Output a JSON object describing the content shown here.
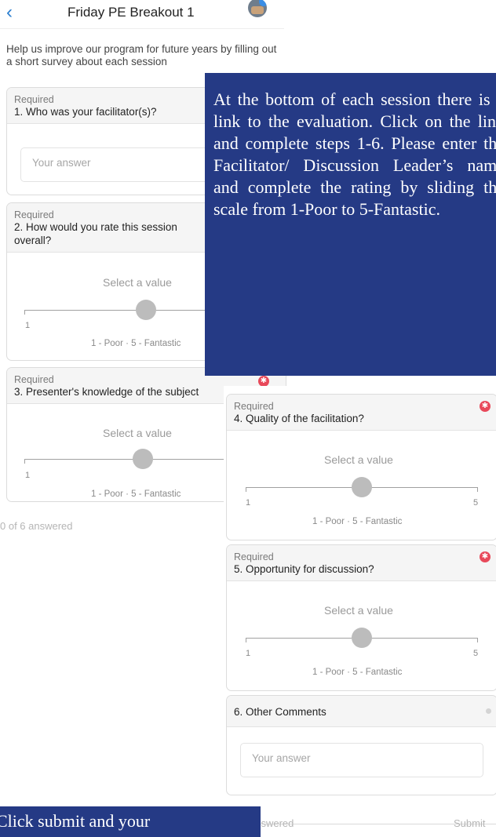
{
  "nav": {
    "back_icon": "chevron-left-icon",
    "title": "Friday PE Breakout 1",
    "avatar_icon": "avatar-icon"
  },
  "intro": "Help us improve our program for future years by filling out a short survey about each session",
  "left_questions": {
    "q1": {
      "required": "Required",
      "text": "1. Who was your facilitator(s)?",
      "placeholder": "Your answer"
    },
    "q2": {
      "required": "Required",
      "text": "2. How would you rate this session overall?",
      "select": "Select a value",
      "min": "1",
      "max": "5",
      "scale": "1 - Poor · 5 - Fantastic",
      "value": 3
    },
    "q3": {
      "required": "Required",
      "text": "3. Presenter's knowledge of the subject",
      "select": "Select a value",
      "min": "1",
      "scale": "1 - Poor · 5 - Fantastic",
      "value": 3
    }
  },
  "left_answered": "0 of 6 answered",
  "instruction_text": "At the bottom of each session there is a link to the evaluation. Click on the link and complete steps 1-6. Please enter the Facilitator/ Discussion Leader’s name and complete the rating by sliding the scale from 1-Poor to 5-Fantastic.",
  "right_questions": {
    "q4": {
      "required": "Required",
      "text": "4. Quality of the facilitation?",
      "select": "Select a value",
      "min": "1",
      "max": "5",
      "scale": "1 - Poor · 5 - Fantastic",
      "value": 3
    },
    "q5": {
      "required": "Required",
      "text": "5. Opportunity for discussion?",
      "select": "Select a value",
      "min": "1",
      "max": "5",
      "scale": "1 - Poor · 5 - Fantastic",
      "value": 3
    },
    "q6": {
      "text": "6. Other Comments",
      "placeholder": "Your answer"
    }
  },
  "footer": {
    "answered": "answered",
    "submit": "Submit"
  },
  "bottom_text": "Click submit and your",
  "colors": {
    "accent_blue": "#2b7fd0",
    "required_red": "#e8495a",
    "instruction_box": "#253a85"
  }
}
